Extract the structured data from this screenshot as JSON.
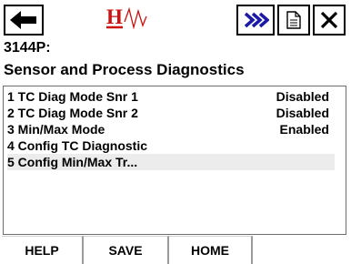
{
  "toolbar": {
    "back_icon": "left-arrow-icon",
    "logo": "hart-logo",
    "forward_icon": "double-chevron-right-icon",
    "document_icon": "document-icon",
    "close_icon": "close-icon",
    "accent_color": "#cc1111",
    "forward_color": "#1a1aa6"
  },
  "device_tag": "3144P:",
  "page_title": "Sensor and Process Diagnostics",
  "menu": {
    "items": [
      {
        "label": "1 TC Diag Mode Snr 1",
        "value": "Disabled"
      },
      {
        "label": "2 TC Diag Mode Snr 2",
        "value": "Disabled"
      },
      {
        "label": "3 Min/Max Mode",
        "value": "Enabled"
      },
      {
        "label": "4 Config TC Diagnostic",
        "value": ""
      },
      {
        "label": "5 Config Min/Max Tr...",
        "value": ""
      }
    ],
    "selected_index": 4
  },
  "bottom": {
    "help": "HELP",
    "save": "SAVE",
    "home": "HOME"
  }
}
